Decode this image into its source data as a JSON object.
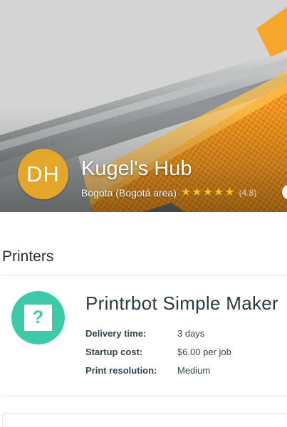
{
  "hub": {
    "initials": "DH",
    "name": "Kugel's Hub",
    "location": "Bogota (Bogotá area)",
    "rating": "(4.8)",
    "stars": 5,
    "star_glyph": "★",
    "colors": {
      "avatar": "#e3a52a",
      "star": "#f5c518"
    }
  },
  "printers": {
    "heading": "Printers",
    "items": [
      {
        "name": "Printrbot Simple Maker",
        "icon": "question-mark-icon",
        "icon_glyph": "?",
        "icon_color": "#3dcaa8",
        "specs": [
          {
            "label": "Delivery time:",
            "value": "3 days"
          },
          {
            "label": "Startup cost:",
            "value": "$6.00 per job"
          },
          {
            "label": "Print resolution:",
            "value": "Medium"
          }
        ]
      }
    ]
  }
}
